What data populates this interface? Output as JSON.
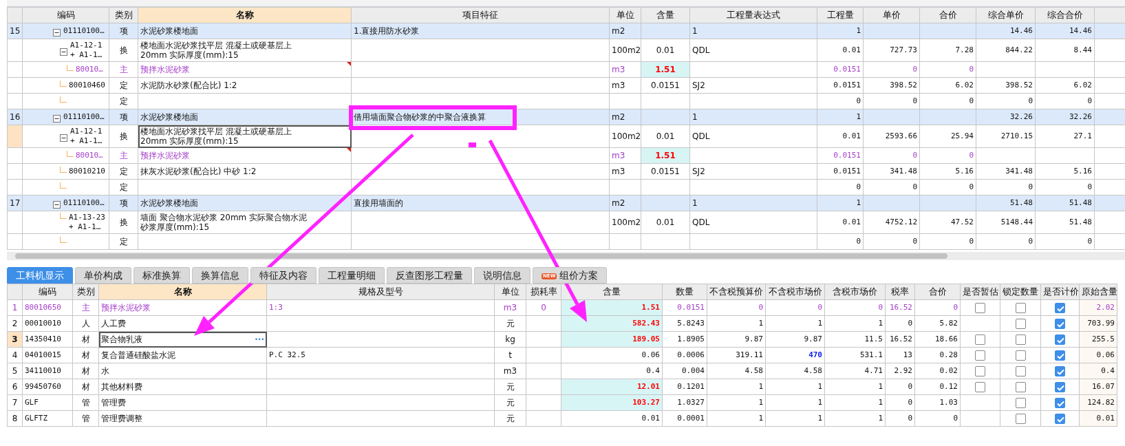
{
  "items": {
    "columns": [
      {
        "label": "编码",
        "selected": false
      },
      {
        "label": "类别",
        "selected": false
      },
      {
        "label": "名称",
        "selected": true
      },
      {
        "label": "项目特征",
        "selected": false
      },
      {
        "label": "单位",
        "selected": false
      },
      {
        "label": "含量",
        "selected": false
      },
      {
        "label": "工程量表达式",
        "selected": false
      },
      {
        "label": "工程量",
        "selected": false
      },
      {
        "label": "单价",
        "selected": false
      },
      {
        "label": "合价",
        "selected": false
      },
      {
        "label": "综合单价",
        "selected": false
      },
      {
        "label": "综合合价",
        "selected": false
      }
    ],
    "rows": [
      {
        "kind": "item",
        "selected": false,
        "expanded": true,
        "num": "15",
        "code": "01110100…",
        "type": "项",
        "name": "水泥砂浆楼地面",
        "feature": "1.直接用防水砂浆",
        "unit": "m2",
        "expr": "1",
        "qty": "1",
        "cprice": "14.46",
        "ctotal": "14.46",
        "children": [
          {
            "kind": "sub",
            "selected": false,
            "expanded": true,
            "code": "A1-12-1\n+ A1-1…",
            "type": "换",
            "name": "楼地面水泥砂浆找平层 混凝土或硬基层上 20mm  实际厚度(mm):15",
            "unit": "100m2",
            "content": "0.01",
            "expr": "QDL",
            "qty": "0.01",
            "price": "727.73",
            "total": "7.28",
            "cprice": "844.22",
            "ctotal": "8.44",
            "children": [
              {
                "kind": "main",
                "selected": false,
                "code": "80010…",
                "type": "主",
                "name": "预拌水泥砂浆",
                "unit": "m3",
                "content": "1.51",
                "qty": "0.0151",
                "price": "0",
                "total": "0"
              }
            ]
          },
          {
            "kind": "quota",
            "selected": false,
            "code": "80010460",
            "type": "定",
            "name": "水泥防水砂浆(配合比) 1:2",
            "unit": "m3",
            "content": "0.0151",
            "expr": "SJ2",
            "qty": "0.0151",
            "price": "398.52",
            "total": "6.02",
            "cprice": "398.52",
            "ctotal": "6.02"
          },
          {
            "kind": "quota",
            "selected": false,
            "type": "定",
            "qty": "0",
            "price": "0",
            "total": "0",
            "cprice": "0",
            "ctotal": "0"
          }
        ]
      },
      {
        "kind": "item",
        "selected": false,
        "expanded": true,
        "num": "16",
        "code": "01110100…",
        "type": "项",
        "name": "水泥砂浆楼地面",
        "feature": "借用墙面聚合物砂浆的中聚合液换算",
        "unit": "m2",
        "expr": "1",
        "qty": "1",
        "cprice": "32.26",
        "ctotal": "32.26",
        "children": [
          {
            "kind": "sub",
            "selected": true,
            "expanded": true,
            "code": "A1-12-1\n+ A1-1…",
            "type": "换",
            "name": "楼地面水泥砂浆找平层 混凝土或硬基层上 20mm  实际厚度(mm):15",
            "unit": "100m2",
            "content": "0.01",
            "expr": "QDL",
            "qty": "0.01",
            "price": "2593.66",
            "total": "25.94",
            "cprice": "2710.15",
            "ctotal": "27.1",
            "children": [
              {
                "kind": "main",
                "selected": false,
                "code": "80010…",
                "type": "主",
                "name": "预拌水泥砂浆",
                "unit": "m3",
                "content": "1.51",
                "qty": "0.0151",
                "price": "0",
                "total": "0"
              }
            ]
          },
          {
            "kind": "quota",
            "selected": false,
            "code": "80010210",
            "type": "定",
            "name": "抹灰水泥砂浆(配合比) 中砂 1:2",
            "unit": "m3",
            "content": "0.0151",
            "expr": "SJ2",
            "qty": "0.0151",
            "price": "341.48",
            "total": "5.16",
            "cprice": "341.48",
            "ctotal": "5.16"
          },
          {
            "kind": "quota",
            "selected": false,
            "type": "定",
            "qty": "0",
            "price": "0",
            "total": "0",
            "cprice": "0",
            "ctotal": "0"
          }
        ]
      },
      {
        "kind": "item",
        "selected": false,
        "expanded": true,
        "num": "17",
        "code": "01110100…",
        "type": "项",
        "name": "水泥砂浆楼地面",
        "feature": "直接用墙面的",
        "unit": "m2",
        "expr": "1",
        "qty": "1",
        "cprice": "51.48",
        "ctotal": "51.48",
        "children": [
          {
            "kind": "sub",
            "selected": false,
            "code": "A1-13-23\n+ A1-1…",
            "type": "换",
            "name": "墙面 聚合物水泥砂浆 20mm  实际聚合物水泥砂浆厚度(mm):15",
            "unit": "100m2",
            "content": "0.01",
            "expr": "QDL",
            "qty": "0.01",
            "price": "4752.12",
            "total": "47.52",
            "cprice": "5148.44",
            "ctotal": "51.48"
          },
          {
            "kind": "quota",
            "selected": false,
            "type": "定",
            "qty": "0",
            "price": "0",
            "total": "0",
            "cprice": "0",
            "ctotal": "0"
          }
        ]
      }
    ]
  },
  "detail_tabs": [
    {
      "label": "工料机显示",
      "selected": true
    },
    {
      "label": "单价构成",
      "selected": false
    },
    {
      "label": "标准换算",
      "selected": false
    },
    {
      "label": "换算信息",
      "selected": false
    },
    {
      "label": "特征及内容",
      "selected": false
    },
    {
      "label": "工程量明细",
      "selected": false
    },
    {
      "label": "反查图形工程量",
      "selected": false
    },
    {
      "label": "说明信息",
      "selected": false
    },
    {
      "label": "组价方案",
      "selected": false,
      "badge": "NEW"
    }
  ],
  "materials": {
    "more_button": "···",
    "columns": [
      {
        "label": "编码",
        "selected": false
      },
      {
        "label": "类别",
        "selected": false
      },
      {
        "label": "名称",
        "selected": true
      },
      {
        "label": "规格及型号",
        "selected": false
      },
      {
        "label": "单位",
        "selected": false
      },
      {
        "label": "损耗率",
        "selected": false
      },
      {
        "label": "含量",
        "selected": false
      },
      {
        "label": "数量",
        "selected": false
      },
      {
        "label": "不含税预算价",
        "selected": false
      },
      {
        "label": "不含税市场价",
        "selected": false
      },
      {
        "label": "含税市场价",
        "selected": false
      },
      {
        "label": "税率",
        "selected": false
      },
      {
        "label": "合价",
        "selected": false
      },
      {
        "label": "是否暂估",
        "selected": false
      },
      {
        "label": "锁定数量",
        "selected": false
      },
      {
        "label": "是否计价",
        "selected": false
      },
      {
        "label": "原始含量",
        "selected": false
      }
    ],
    "rows": [
      {
        "kind": "main",
        "selected": false,
        "highlighted": true,
        "market_adjusted": false,
        "num": "1",
        "code": "80010650",
        "type": "主",
        "name": "预拌水泥砂浆",
        "spec": "1:3",
        "unit": "m3",
        "loss": "0",
        "content": "1.51",
        "qty": "0.0151",
        "budget": "0",
        "market": "0",
        "market_tax": "0",
        "tax": "16.52",
        "total": "0",
        "provisional": false,
        "locked": false,
        "priced": true,
        "original": "2.02"
      },
      {
        "kind": "normal",
        "selected": false,
        "highlighted": true,
        "market_adjusted": false,
        "num": "2",
        "code": "00010010",
        "type": "人",
        "name": "人工费",
        "unit": "元",
        "content": "582.43",
        "qty": "5.8243",
        "budget": "1",
        "market": "1",
        "market_tax": "1",
        "tax": "0",
        "total": "5.82",
        "locked": false,
        "priced": true,
        "original": "703.99"
      },
      {
        "kind": "normal",
        "selected": true,
        "highlighted": true,
        "market_adjusted": false,
        "num": "3",
        "code": "14350410",
        "type": "材",
        "name": "聚合物乳液",
        "unit": "kg",
        "content": "189.05",
        "qty": "1.8905",
        "budget": "9.87",
        "market": "9.87",
        "market_tax": "11.5",
        "tax": "16.52",
        "total": "18.66",
        "provisional": false,
        "locked": false,
        "priced": true,
        "original": "255.5"
      },
      {
        "kind": "normal",
        "selected": false,
        "highlighted": false,
        "market_adjusted": true,
        "num": "4",
        "code": "04010015",
        "type": "材",
        "name": "复合普通硅酸盐水泥",
        "spec": "P.C 32.5",
        "unit": "t",
        "content": "0.06",
        "qty": "0.0006",
        "budget": "319.11",
        "market": "470",
        "market_tax": "531.1",
        "tax": "13",
        "total": "0.28",
        "provisional": false,
        "locked": false,
        "priced": true,
        "original": "0.06"
      },
      {
        "kind": "normal",
        "selected": false,
        "highlighted": false,
        "market_adjusted": false,
        "num": "5",
        "code": "34110010",
        "type": "材",
        "name": "水",
        "unit": "m3",
        "content": "0.4",
        "qty": "0.004",
        "budget": "4.58",
        "market": "4.58",
        "market_tax": "4.71",
        "tax": "2.92",
        "total": "0.02",
        "provisional": false,
        "locked": false,
        "priced": true,
        "original": "0.4"
      },
      {
        "kind": "normal",
        "selected": false,
        "highlighted": true,
        "market_adjusted": false,
        "num": "6",
        "code": "99450760",
        "type": "材",
        "name": "其他材料费",
        "unit": "元",
        "content": "12.01",
        "qty": "0.1201",
        "budget": "1",
        "market": "1",
        "market_tax": "1",
        "tax": "0",
        "total": "0.12",
        "provisional": false,
        "locked": false,
        "priced": true,
        "original": "16.07"
      },
      {
        "kind": "normal",
        "selected": false,
        "highlighted": true,
        "market_adjusted": false,
        "num": "7",
        "code": "GLF",
        "type": "管",
        "name": "管理费",
        "unit": "元",
        "content": "103.27",
        "qty": "1.0327",
        "budget": "1",
        "market": "1",
        "market_tax": "1",
        "tax": "0",
        "total": "1.03",
        "locked": false,
        "priced": true,
        "original": "124.82"
      },
      {
        "kind": "normal",
        "selected": false,
        "highlighted": false,
        "market_adjusted": false,
        "num": "8",
        "code": "GLFTZ",
        "type": "管",
        "name": "管理费调整",
        "unit": "元",
        "content": "0.01",
        "qty": "0.0001",
        "budget": "1",
        "market": "1",
        "market_tax": "1",
        "tax": "0",
        "total": "0",
        "locked": false,
        "priced": true,
        "original": "0.01"
      }
    ]
  }
}
